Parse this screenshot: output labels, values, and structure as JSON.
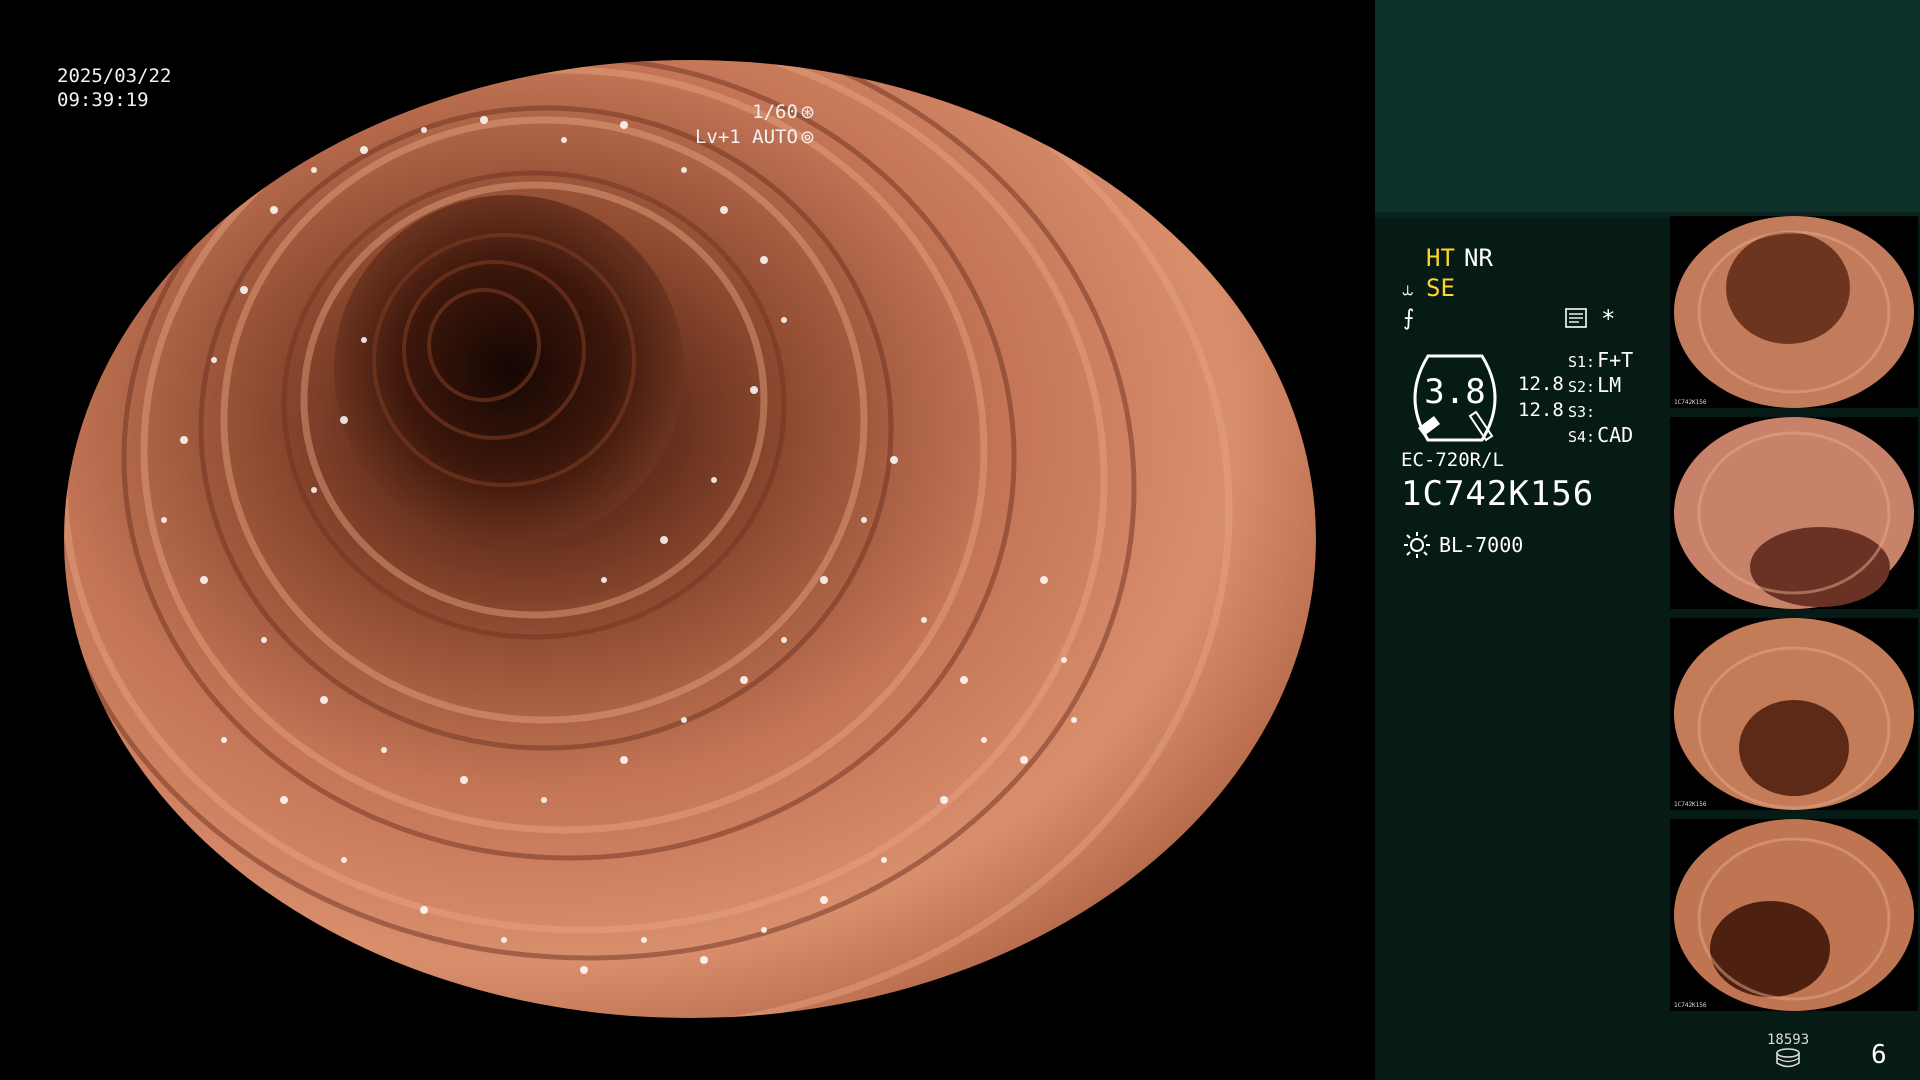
{
  "overlay": {
    "date": "2025/03/22",
    "time": "09:39:19",
    "shutter": "1/60",
    "shutter_icon": "aperture-icon",
    "iris": "Lv+1 AUTO",
    "iris_icon": "iris-icon"
  },
  "panel": {
    "ht": "HT",
    "nr": "NR",
    "se": "SE",
    "se_icon": "structure-enhancement-icon",
    "freq_icon": "frequency-icon",
    "memo_icon": "memo-icon",
    "star": "*",
    "gauge_value": "3.8",
    "value_top": "12.8",
    "value_bottom": "12.8",
    "switches": [
      {
        "key": "S1:",
        "value": "F+T"
      },
      {
        "key": "S2:",
        "value": "LM"
      },
      {
        "key": "S3:",
        "value": ""
      },
      {
        "key": "S4:",
        "value": "CAD"
      }
    ],
    "scope_model": "EC-720R/L",
    "scope_serial": "1C742K156",
    "light_source_icon": "light-source-icon",
    "light_source": "BL-7000",
    "image_counter": "18593",
    "storage_icon": "storage-disk-icon",
    "page_number": "6"
  },
  "thumbnails": [
    {
      "label": "1C742K156"
    },
    {
      "label": ""
    },
    {
      "label": "1C742K156"
    },
    {
      "label": "1C742K156"
    }
  ],
  "colors": {
    "panel_bg": "#061a16",
    "panel_top_bg": "#0d3029",
    "highlight_yellow": "#ffd52a",
    "tissue": "#c97a58"
  }
}
